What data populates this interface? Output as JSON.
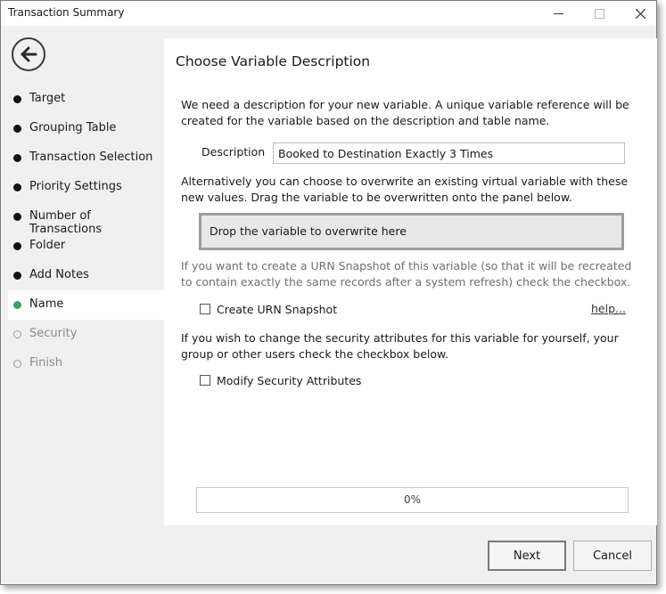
{
  "window": {
    "title": "Transaction Summary",
    "controls": {
      "minimize": "minimize-icon",
      "maximize": "maximize-icon",
      "close": "close-icon"
    }
  },
  "nav": {
    "back_icon": "back-arrow-icon",
    "steps": [
      {
        "label": "Target",
        "state": "done"
      },
      {
        "label": "Grouping Table",
        "state": "done"
      },
      {
        "label": "Transaction Selection",
        "state": "done"
      },
      {
        "label": "Priority Settings",
        "state": "done"
      },
      {
        "label": "Number of Transactions",
        "state": "done"
      },
      {
        "label": "Folder",
        "state": "done"
      },
      {
        "label": "Add Notes",
        "state": "done"
      },
      {
        "label": "Name",
        "state": "active"
      },
      {
        "label": "Security",
        "state": "pending"
      },
      {
        "label": "Finish",
        "state": "pending"
      }
    ]
  },
  "main": {
    "heading": "Choose Variable Description",
    "intro": "We need a description for your new variable.  A unique variable reference will be created for the variable based on the description and table name.",
    "description_label": "Description",
    "description_value": "Booked to Destination Exactly 3 Times",
    "overwrite_text": "Alternatively you can choose to overwrite an existing virtual variable with these new values. Drag the variable to be overwritten onto the panel below.",
    "drop_zone_text": "Drop the variable to overwrite here",
    "urn_text": "If you want to create a URN Snapshot of this variable (so that it will be recreated to contain exactly the same records after a system refresh) check the checkbox.",
    "urn_checkbox_label": "Create URN Snapshot",
    "urn_checked": false,
    "help_link": "help...",
    "security_text": "If you wish to change the security attributes for this variable for yourself, your group or other users check the checkbox below.",
    "security_checkbox_label": "Modify Security Attributes",
    "security_checked": false,
    "progress_label": "0%",
    "progress_fraction": 0
  },
  "footer": {
    "next_label": "Next",
    "cancel_label": "Cancel"
  },
  "colors": {
    "active_step": "#3aa35b",
    "panel_bg": "#ffffff",
    "window_bg": "#f0f0f0"
  }
}
